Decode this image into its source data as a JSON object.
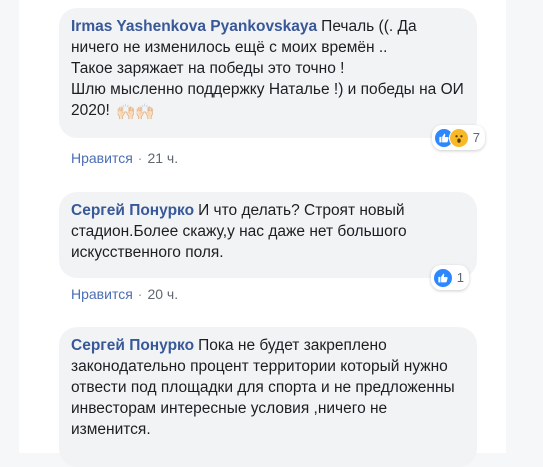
{
  "comments": [
    {
      "author": "Irmas Yashenkova Pyankovskaya",
      "text": "Печаль ((. Да ничего не изменилось ещё с моих времён ..\nТакое заряжает на победы это точно !\nШлю мысленно поддержку Наталье !) и победы на ОИ 2020!",
      "emoji": "🙌🏻🙌🏻",
      "reactions": {
        "icons": [
          "like-icon",
          "wow-icon"
        ],
        "count": "7"
      },
      "like_label": "Нравится",
      "time": "21 ч."
    },
    {
      "author": "Сергей Понурко",
      "text": "И что делать? Строят новый стадион.Более скажу,у нас даже нет большого искусственного поля.",
      "reactions": {
        "icons": [
          "like-icon"
        ],
        "count": "1"
      },
      "like_label": "Нравится",
      "time": "20 ч."
    },
    {
      "author": "Сергей Понурко",
      "text": "Пока не будет закреплено законодательно процент территории который нужно отвести под площадки для спорта и не предложенны инвесторам интересные условия ,ничего не изменится."
    }
  ],
  "colors": {
    "author": "#385898",
    "bubble": "#f2f3f5",
    "like_blue": "#2d88ff",
    "wow_yellow": "#f7b928"
  }
}
